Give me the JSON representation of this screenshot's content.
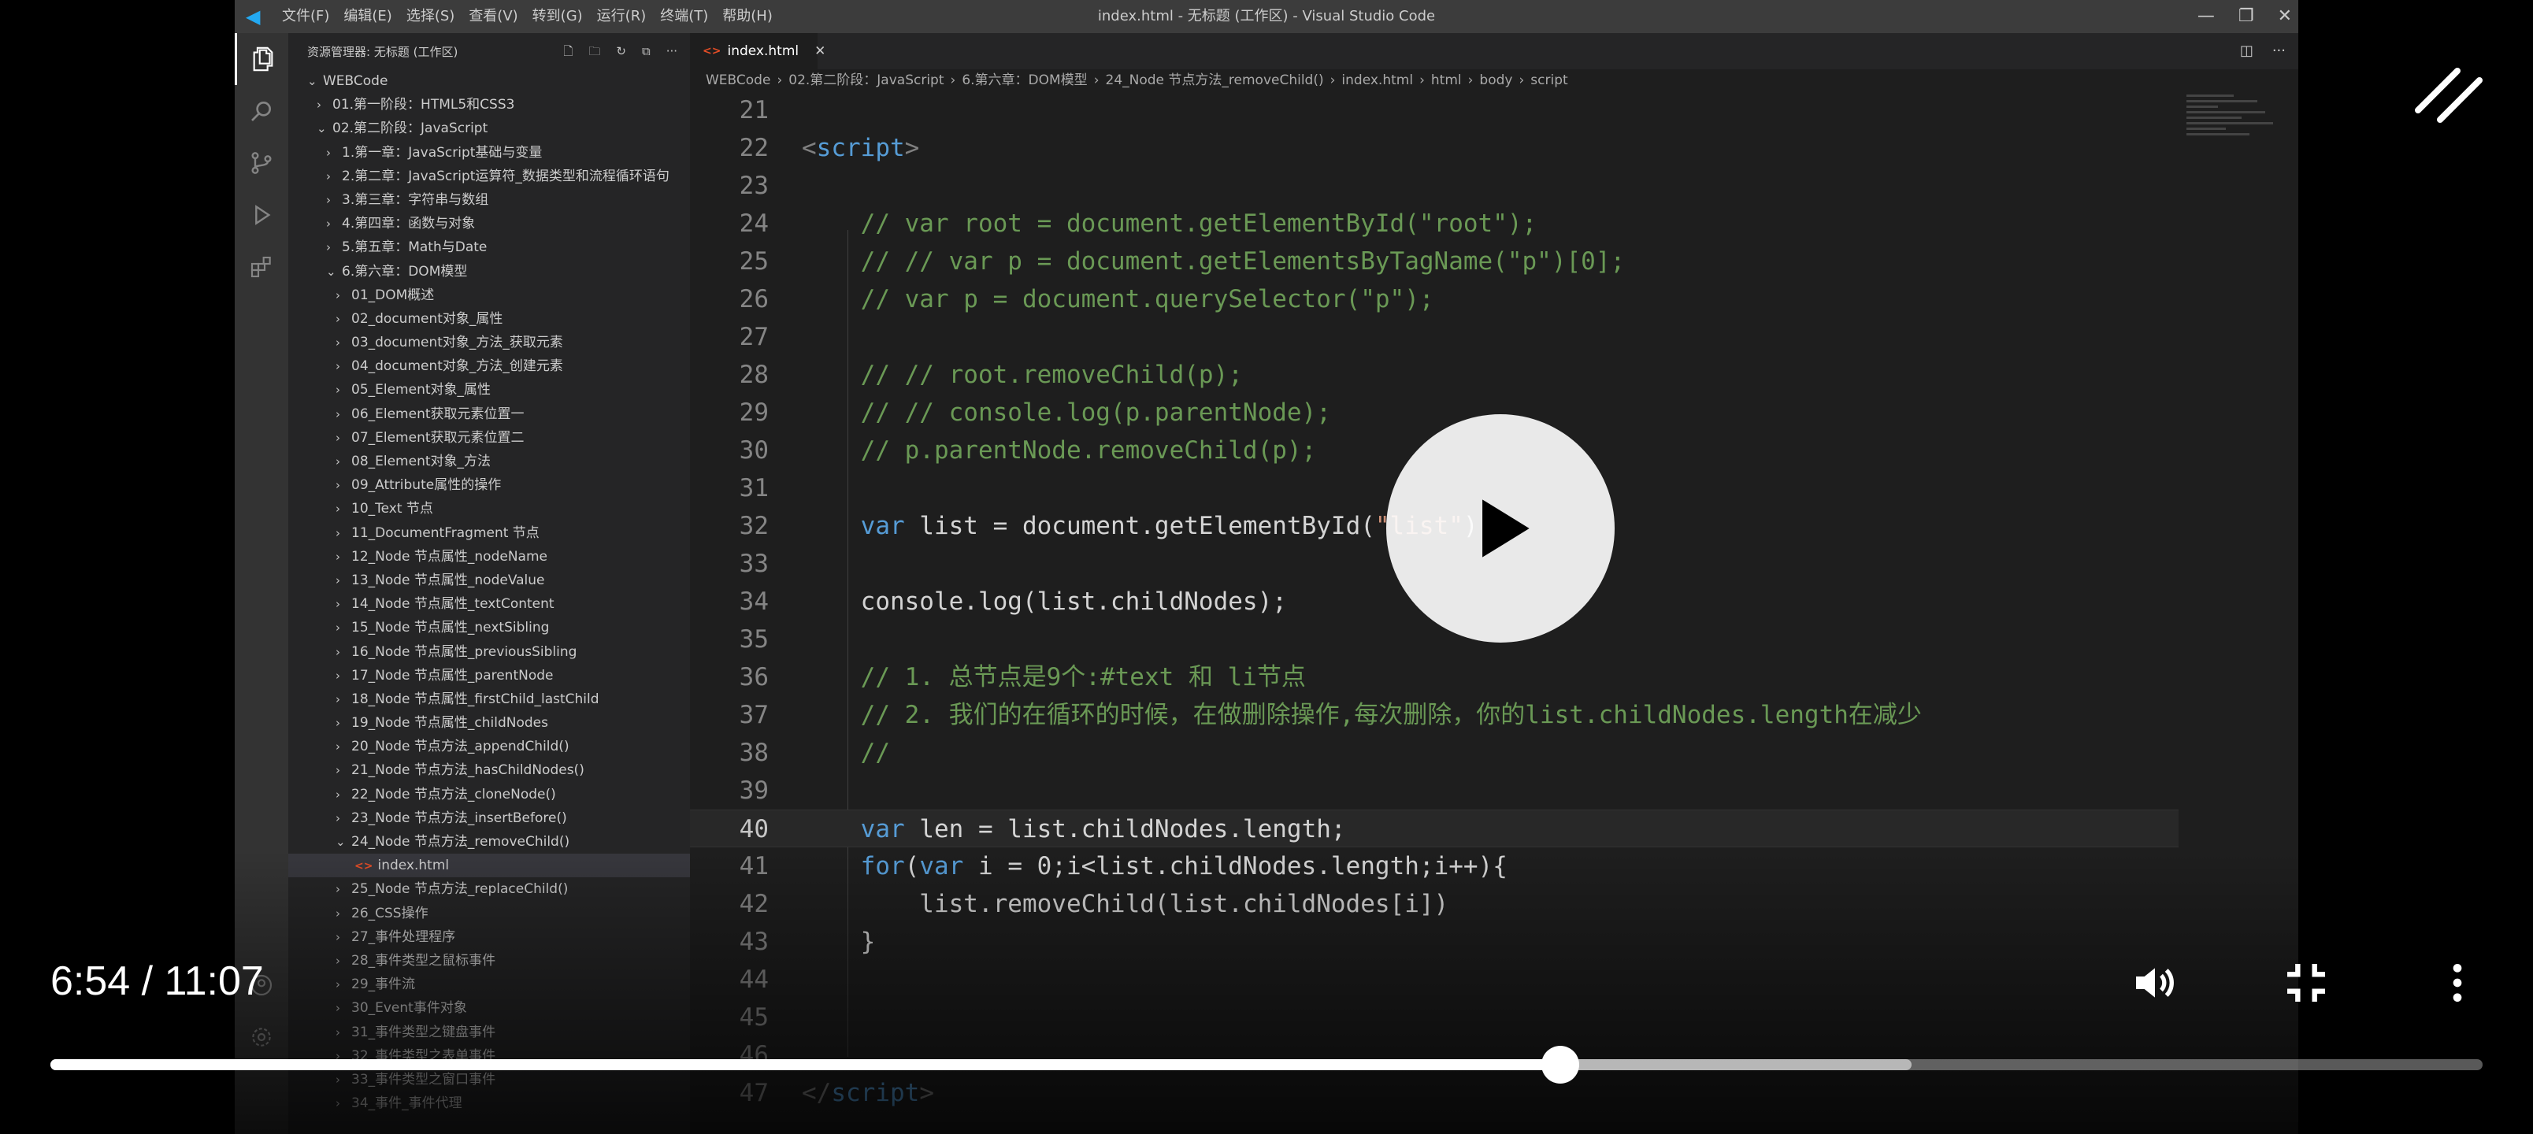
{
  "window": {
    "title": "index.html - 无标题 (工作区) - Visual Studio Code",
    "menu": [
      "文件(F)",
      "编辑(E)",
      "选择(S)",
      "查看(V)",
      "转到(G)",
      "运行(R)",
      "终端(T)",
      "帮助(H)"
    ]
  },
  "sidebar": {
    "header": "资源管理器: 无标题 (工作区)",
    "root": "WEBCode",
    "items": [
      {
        "label": "01.第一阶段：HTML5和CSS3",
        "chev": "›"
      },
      {
        "label": "02.第二阶段：JavaScript",
        "chev": "⌄"
      },
      {
        "label": "1.第一章：JavaScript基础与变量",
        "chev": "›"
      },
      {
        "label": "2.第二章：JavaScript运算符_数据类型和流程循环语句",
        "chev": "›"
      },
      {
        "label": "3.第三章：字符串与数组",
        "chev": "›"
      },
      {
        "label": "4.第四章：函数与对象",
        "chev": "›"
      },
      {
        "label": "5.第五章：Math与Date",
        "chev": "›"
      },
      {
        "label": "6.第六章：DOM模型",
        "chev": "⌄"
      },
      {
        "label": "01_DOM概述",
        "chev": "›"
      },
      {
        "label": "02_document对象_属性",
        "chev": "›"
      },
      {
        "label": "03_document对象_方法_获取元素",
        "chev": "›"
      },
      {
        "label": "04_document对象_方法_创建元素",
        "chev": "›"
      },
      {
        "label": "05_Element对象_属性",
        "chev": "›"
      },
      {
        "label": "06_Element获取元素位置一",
        "chev": "›"
      },
      {
        "label": "07_Element获取元素位置二",
        "chev": "›"
      },
      {
        "label": "08_Element对象_方法",
        "chev": "›"
      },
      {
        "label": "09_Attribute属性的操作",
        "chev": "›"
      },
      {
        "label": "10_Text 节点",
        "chev": "›"
      },
      {
        "label": "11_DocumentFragment 节点",
        "chev": "›"
      },
      {
        "label": "12_Node 节点属性_nodeName",
        "chev": "›"
      },
      {
        "label": "13_Node 节点属性_nodeValue",
        "chev": "›"
      },
      {
        "label": "14_Node 节点属性_textContent",
        "chev": "›"
      },
      {
        "label": "15_Node 节点属性_nextSibling",
        "chev": "›"
      },
      {
        "label": "16_Node 节点属性_previousSibling",
        "chev": "›"
      },
      {
        "label": "17_Node 节点属性_parentNode",
        "chev": "›"
      },
      {
        "label": "18_Node 节点属性_firstChild_lastChild",
        "chev": "›"
      },
      {
        "label": "19_Node 节点属性_childNodes",
        "chev": "›"
      },
      {
        "label": "20_Node 节点方法_appendChild()",
        "chev": "›"
      },
      {
        "label": "21_Node 节点方法_hasChildNodes()",
        "chev": "›"
      },
      {
        "label": "22_Node 节点方法_cloneNode()",
        "chev": "›"
      },
      {
        "label": "23_Node 节点方法_insertBefore()",
        "chev": "›"
      },
      {
        "label": "24_Node 节点方法_removeChild()",
        "chev": "⌄"
      },
      {
        "label": "index.html",
        "chev": ""
      },
      {
        "label": "25_Node 节点方法_replaceChild()",
        "chev": "›"
      },
      {
        "label": "26_CSS操作",
        "chev": "›"
      },
      {
        "label": "27_事件处理程序",
        "chev": "›"
      },
      {
        "label": "28_事件类型之鼠标事件",
        "chev": "›"
      },
      {
        "label": "29_事件流",
        "chev": "›"
      },
      {
        "label": "30_Event事件对象",
        "chev": "›"
      },
      {
        "label": "31_事件类型之键盘事件",
        "chev": "›"
      },
      {
        "label": "32_事件类型之表单事件",
        "chev": "›"
      },
      {
        "label": "33_事件类型之窗口事件",
        "chev": "›"
      },
      {
        "label": "34_事件_事件代理",
        "chev": "›"
      }
    ]
  },
  "editor": {
    "tab": "index.html",
    "breadcrumb": [
      "WEBCode",
      "02.第二阶段：JavaScript",
      "6.第六章：DOM模型",
      "24_Node 节点方法_removeChild()",
      "index.html",
      "html",
      "body",
      "script"
    ],
    "lines": [
      {
        "n": "21",
        "parts": []
      },
      {
        "n": "22",
        "parts": [
          {
            "c": "t",
            "t": "<"
          },
          {
            "c": "k",
            "t": "script"
          },
          {
            "c": "t",
            "t": ">"
          }
        ]
      },
      {
        "n": "23",
        "parts": []
      },
      {
        "n": "24",
        "parts": [
          {
            "c": "c",
            "t": "    // var root = document.getElementById(\"root\");"
          }
        ]
      },
      {
        "n": "25",
        "parts": [
          {
            "c": "c",
            "t": "    // // var p = document.getElementsByTagName(\"p\")[0];"
          }
        ]
      },
      {
        "n": "26",
        "parts": [
          {
            "c": "c",
            "t": "    // var p = document.querySelector(\"p\");"
          }
        ]
      },
      {
        "n": "27",
        "parts": []
      },
      {
        "n": "28",
        "parts": [
          {
            "c": "c",
            "t": "    // // root.removeChild(p);"
          }
        ]
      },
      {
        "n": "29",
        "parts": [
          {
            "c": "c",
            "t": "    // // console.log(p.parentNode);"
          }
        ]
      },
      {
        "n": "30",
        "parts": [
          {
            "c": "c",
            "t": "    // p.parentNode.removeChild(p);"
          }
        ]
      },
      {
        "n": "31",
        "parts": []
      },
      {
        "n": "32",
        "parts": [
          {
            "c": "p",
            "t": "    "
          },
          {
            "c": "k",
            "t": "var"
          },
          {
            "c": "p",
            "t": " list = document.getElementById("
          },
          {
            "c": "s",
            "t": "\"list\""
          },
          {
            "c": "p",
            "t": ");"
          }
        ]
      },
      {
        "n": "33",
        "parts": []
      },
      {
        "n": "34",
        "parts": [
          {
            "c": "p",
            "t": "    console.log(list.childNodes);"
          }
        ]
      },
      {
        "n": "35",
        "parts": []
      },
      {
        "n": "36",
        "parts": [
          {
            "c": "c",
            "t": "    // 1. 总节点是9个:#text 和 li节点"
          }
        ]
      },
      {
        "n": "37",
        "parts": [
          {
            "c": "c",
            "t": "    // 2. 我们的在循环的时候，在做删除操作,每次删除，你的list.childNodes.length在减少"
          }
        ]
      },
      {
        "n": "38",
        "parts": [
          {
            "c": "c",
            "t": "    //"
          }
        ]
      },
      {
        "n": "39",
        "parts": []
      },
      {
        "n": "40",
        "parts": [
          {
            "c": "p",
            "t": "    "
          },
          {
            "c": "k",
            "t": "var"
          },
          {
            "c": "p",
            "t": " len = list.childNodes.length;"
          }
        ],
        "current": true
      },
      {
        "n": "41",
        "parts": [
          {
            "c": "p",
            "t": "    "
          },
          {
            "c": "k",
            "t": "for"
          },
          {
            "c": "p",
            "t": "("
          },
          {
            "c": "k",
            "t": "var"
          },
          {
            "c": "p",
            "t": " i = 0;i<list.childNodes.length;i++){"
          }
        ]
      },
      {
        "n": "42",
        "parts": [
          {
            "c": "p",
            "t": "        list.removeChild(list.childNodes[i])"
          }
        ]
      },
      {
        "n": "43",
        "parts": [
          {
            "c": "p",
            "t": "    }"
          }
        ]
      },
      {
        "n": "44",
        "parts": []
      },
      {
        "n": "45",
        "parts": []
      },
      {
        "n": "46",
        "parts": []
      },
      {
        "n": "47",
        "parts": [
          {
            "c": "t",
            "t": "</"
          },
          {
            "c": "k",
            "t": "script"
          },
          {
            "c": "t",
            "t": ">"
          }
        ]
      }
    ]
  },
  "player": {
    "current_time": "6:54",
    "duration": "11:07",
    "time_display": "6:54 / 11:07",
    "played_fraction": 0.6207,
    "buffered_fraction": 0.7653,
    "icons": [
      "play-icon",
      "volume-icon",
      "exit-fullscreen-icon",
      "more-icon",
      "collapse-icon"
    ]
  }
}
